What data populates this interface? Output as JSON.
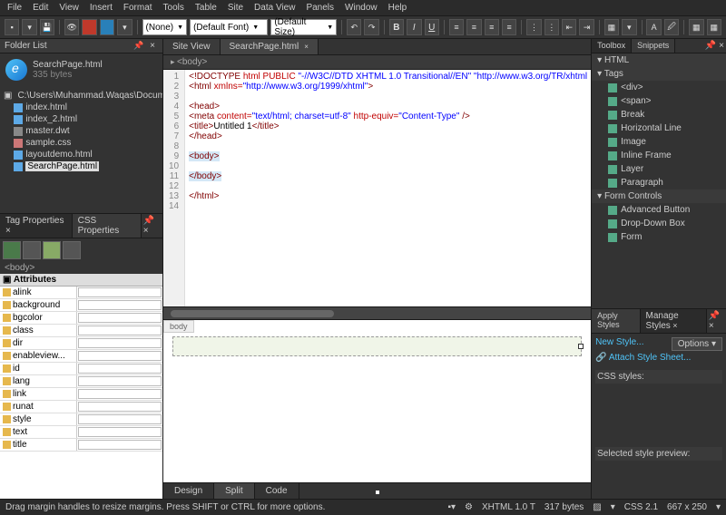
{
  "menu": [
    "File",
    "Edit",
    "View",
    "Insert",
    "Format",
    "Tools",
    "Table",
    "Site",
    "Data View",
    "Panels",
    "Window",
    "Help"
  ],
  "toolbar": {
    "style_select": "(None)",
    "font_select": "(Default Font)",
    "size_select": "(Default Size)"
  },
  "folder_panel": {
    "title": "Folder List",
    "file_name": "SearchPage.html",
    "file_size": "335 bytes",
    "root": "C:\\Users\\Muhammad.Waqas\\Documents\\M...",
    "files": [
      {
        "name": "index.html",
        "type": "html"
      },
      {
        "name": "index_2.html",
        "type": "html"
      },
      {
        "name": "master.dwt",
        "type": "dwt"
      },
      {
        "name": "sample.css",
        "type": "css"
      },
      {
        "name": "layoutdemo.html",
        "type": "html"
      },
      {
        "name": "SearchPage.html",
        "type": "html",
        "selected": true
      }
    ]
  },
  "tag_panel": {
    "tabs": [
      "Tag Properties",
      "CSS Properties"
    ],
    "context": "<body>",
    "section": "Attributes",
    "attrs": [
      "alink",
      "background",
      "bgcolor",
      "class",
      "dir",
      "enableview...",
      "id",
      "lang",
      "link",
      "runat",
      "style",
      "text",
      "title"
    ]
  },
  "doc": {
    "tabs": [
      {
        "label": "Site View"
      },
      {
        "label": "SearchPage.html",
        "active": true,
        "close": true
      }
    ],
    "crumb": "<body>",
    "lines": [
      {
        "n": 1,
        "html": "<span class='c-tag'>&lt;!DOCTYPE</span> <span class='c-attr'>html PUBLIC</span> <span class='c-str'>\"-//W3C//DTD XHTML 1.0 Transitional//EN\" \"http://www.w3.org/TR/xhtml</span>"
      },
      {
        "n": 2,
        "html": "<span class='c-tag'>&lt;html</span> <span class='c-attr'>xmlns=</span><span class='c-str'>\"http://www.w3.org/1999/xhtml\"</span><span class='c-tag'>&gt;</span>"
      },
      {
        "n": 3,
        "html": ""
      },
      {
        "n": 4,
        "html": "<span class='c-tag'>&lt;head&gt;</span>"
      },
      {
        "n": 5,
        "html": "<span class='c-tag'>&lt;meta</span> <span class='c-attr'>content=</span><span class='c-str'>\"text/html; charset=utf-8\"</span> <span class='c-attr'>http-equiv=</span><span class='c-str'>\"Content-Type\"</span> <span class='c-tag'>/&gt;</span>"
      },
      {
        "n": 6,
        "html": "<span class='c-tag'>&lt;title&gt;</span>Untitled 1<span class='c-tag'>&lt;/title&gt;</span>"
      },
      {
        "n": 7,
        "html": "<span class='c-tag'>&lt;/head&gt;</span>"
      },
      {
        "n": 8,
        "html": ""
      },
      {
        "n": 9,
        "html": "<span class='c-tag hl'>&lt;body&gt;</span>"
      },
      {
        "n": 10,
        "html": ""
      },
      {
        "n": 11,
        "html": "<span class='c-tag hl'>&lt;/body&gt;</span>"
      },
      {
        "n": 12,
        "html": ""
      },
      {
        "n": 13,
        "html": "<span class='c-tag'>&lt;/html&gt;</span>"
      },
      {
        "n": 14,
        "html": ""
      }
    ],
    "design_crumb": "body",
    "view_tabs": [
      "Design",
      "Split",
      "Code"
    ]
  },
  "toolbox": {
    "tabs": [
      "Toolbox",
      "Snippets"
    ],
    "sections": [
      {
        "title": "HTML",
        "open": true
      },
      {
        "title": "Tags",
        "open": true,
        "items": [
          "<div>",
          "<span>",
          "Break",
          "Horizontal Line",
          "Image",
          "Inline Frame",
          "Layer",
          "Paragraph"
        ]
      },
      {
        "title": "Form Controls",
        "open": true,
        "items": [
          "Advanced Button",
          "Drop-Down Box",
          "Form"
        ]
      }
    ]
  },
  "styles": {
    "tabs": [
      "Apply Styles",
      "Manage Styles"
    ],
    "new_style": "New Style...",
    "options": "Options",
    "attach": "Attach Style Sheet...",
    "css_label": "CSS styles:",
    "preview_label": "Selected style preview:"
  },
  "status": {
    "hint": "Drag margin handles to resize margins. Press SHIFT or CTRL for more options.",
    "doctype": "XHTML 1.0 T",
    "bytes": "317 bytes",
    "css": "CSS 2.1",
    "dims": "667 x 250"
  }
}
